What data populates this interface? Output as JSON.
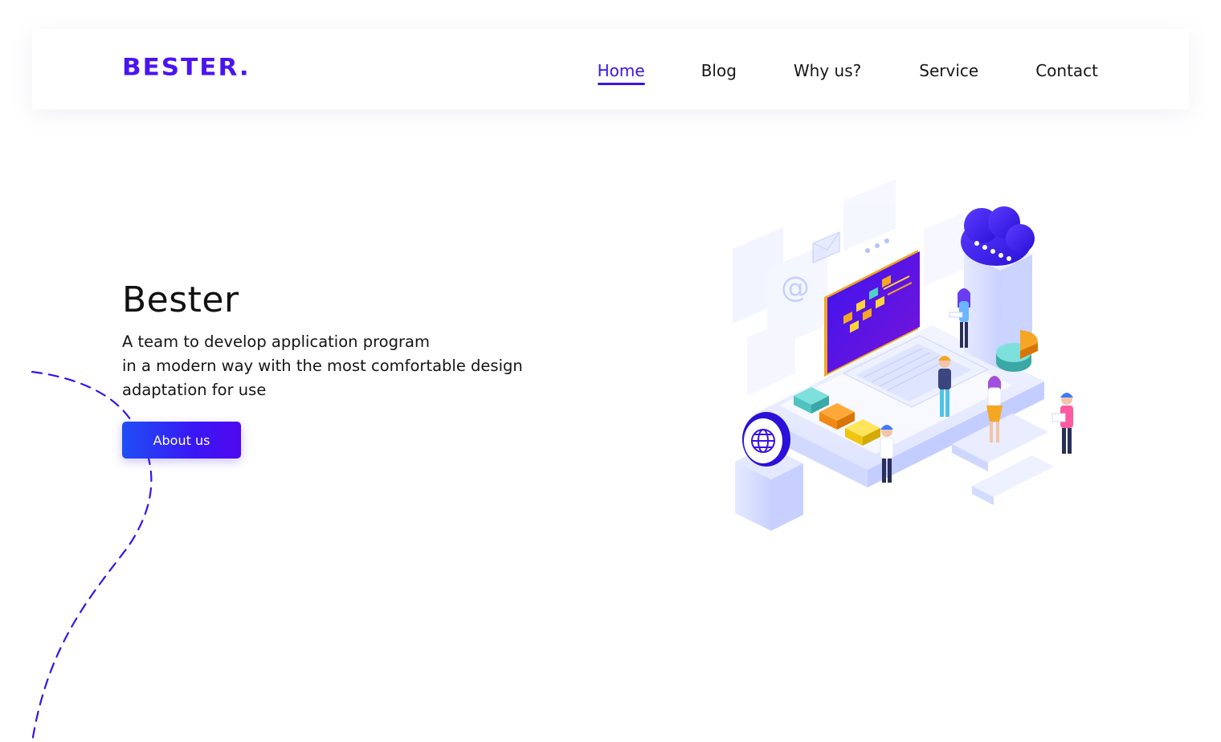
{
  "brand": {
    "logo_text": "BESTER."
  },
  "nav": {
    "items": [
      {
        "label": "Home",
        "active": true
      },
      {
        "label": "Blog",
        "active": false
      },
      {
        "label": "Why us?",
        "active": false
      },
      {
        "label": "Service",
        "active": false
      },
      {
        "label": "Contact",
        "active": false
      }
    ]
  },
  "hero": {
    "title": "Bester",
    "description_lines": [
      "A team to develop application program",
      "in a modern way with the most comfortable design",
      "adaptation for use"
    ],
    "cta_label": "About us"
  },
  "colors": {
    "brand": "#4a14f0",
    "accent": "#3a13e6",
    "text": "#151515",
    "button_gradient_start": "#1f4ff5",
    "button_gradient_end": "#4f08ee"
  },
  "illustration": {
    "icons": [
      "email-icon",
      "at-sign-icon",
      "cloud-icon",
      "globe-icon",
      "pie-chart-icon"
    ]
  }
}
